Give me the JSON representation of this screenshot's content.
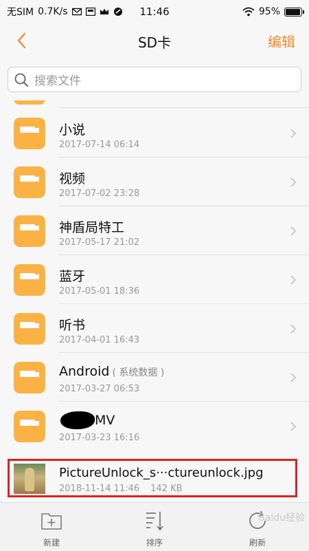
{
  "status_bar": {
    "carrier": "无SIM",
    "speed": "0.7K/s",
    "time": "11:46",
    "battery": "95%",
    "battery_level": 0.95
  },
  "nav": {
    "title": "SD卡",
    "edit_label": "编辑"
  },
  "search": {
    "placeholder": "搜索文件"
  },
  "folders": [
    {
      "name": "小说",
      "date": "2017-07-14 06:14"
    },
    {
      "name": "视频",
      "date": "2017-07-02 23:28"
    },
    {
      "name": "神盾局特工",
      "date": "2017-05-17 21:02"
    },
    {
      "name": "蓝牙",
      "date": "2017-05-01 18:36"
    },
    {
      "name": "听书",
      "date": "2017-04-01 16:43"
    },
    {
      "name": "Android",
      "tag": "( 系统数据 )",
      "date": "2017-03-27 06:53"
    },
    {
      "name": "MV",
      "date": "2017-03-23 16:16"
    }
  ],
  "file": {
    "name": "PictureUnlock_s···ctureunlock.jpg",
    "date": "2018-11-14 11:46",
    "size": "142 KB"
  },
  "toolbar": {
    "new_label": "新建",
    "sort_label": "排序",
    "refresh_label": "刷新"
  },
  "watermark": "Baidu经验",
  "colors": {
    "accent": "#f08c2c",
    "folder": "#fbb245",
    "highlight": "#e02020"
  }
}
